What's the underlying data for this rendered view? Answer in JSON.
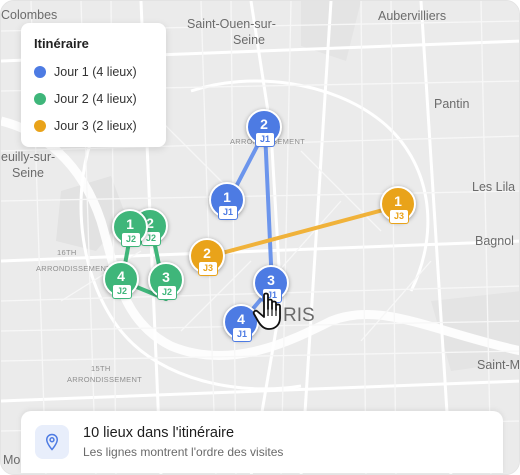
{
  "map": {
    "place_labels": {
      "colombes": "Colombes",
      "saint_ouen_1": "Saint-Ouen-sur-",
      "saint_ouen_2": "Seine",
      "aubervilliers": "Aubervilliers",
      "pantin": "Pantin",
      "neuilly_1": "euilly-sur-",
      "neuilly_2": "Seine",
      "les_lilas": "Les Lila",
      "bagnolet": "Bagnol",
      "saint_mande": "Saint-M",
      "paris": "RIS",
      "arr_16": "ARRONDISSEMENT",
      "arr_16_num": "16TH",
      "arr_15_num": "15TH",
      "arr_15": "ARRONDISSEMENT",
      "arr_18": "ARRONDISSEMENT",
      "mo": "Mo"
    },
    "colors": {
      "jour1": "#4d7be3",
      "jour2": "#3fb67a",
      "jour3": "#e9a31a",
      "route1": "#6c95ec",
      "route3": "#f0b23a"
    }
  },
  "legend": {
    "title": "Itinéraire",
    "items": [
      {
        "label": "Jour 1 (4 lieux)",
        "color": "#4d7be3"
      },
      {
        "label": "Jour 2 (4 lieux)",
        "color": "#3fb67a"
      },
      {
        "label": "Jour 3 (2 lieux)",
        "color": "#e9a31a"
      }
    ]
  },
  "markers": [
    {
      "num": "2",
      "tag": "J1",
      "day": "jour1"
    },
    {
      "num": "1",
      "tag": "J1",
      "day": "jour1"
    },
    {
      "num": "3",
      "tag": "J1",
      "day": "jour1"
    },
    {
      "num": "4",
      "tag": "J1",
      "day": "jour1"
    },
    {
      "num": "1",
      "tag": "J2",
      "day": "jour2"
    },
    {
      "num": "2",
      "tag": "J2",
      "day": "jour2"
    },
    {
      "num": "4",
      "tag": "J2",
      "day": "jour2"
    },
    {
      "num": "3",
      "tag": "J2",
      "day": "jour2"
    },
    {
      "num": "1",
      "tag": "J3",
      "day": "jour3"
    },
    {
      "num": "2",
      "tag": "J3",
      "day": "jour3"
    }
  ],
  "info": {
    "icon": "map-pin-icon",
    "title": "10 lieux dans l'itinéraire",
    "subtitle": "Les lignes montrent l'ordre des visites"
  }
}
